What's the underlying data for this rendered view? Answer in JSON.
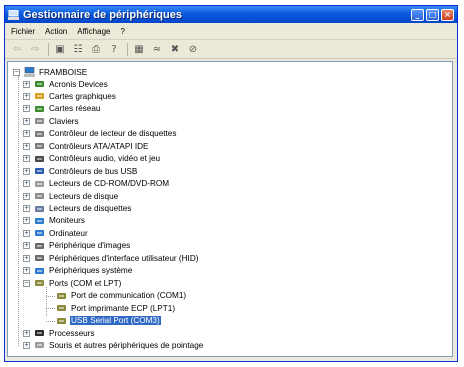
{
  "window": {
    "title": "Gestionnaire de périphériques",
    "min": "_",
    "max": "□",
    "close": "×"
  },
  "menu": [
    {
      "label": "Fichier"
    },
    {
      "label": "Action"
    },
    {
      "label": "Affichage"
    },
    {
      "label": "?"
    }
  ],
  "toolbar": [
    {
      "name": "back-arrow-icon",
      "glyph": "⇦"
    },
    {
      "name": "forward-arrow-icon",
      "glyph": "⇨"
    },
    {
      "name": "console-tree-icon",
      "glyph": "▣"
    },
    {
      "name": "properties-icon",
      "glyph": "☷"
    },
    {
      "name": "print-icon",
      "glyph": "⎙"
    },
    {
      "name": "help-icon",
      "glyph": "?"
    },
    {
      "name": "scan-hardware-icon",
      "glyph": "▦"
    },
    {
      "name": "update-driver-icon",
      "glyph": "≈"
    },
    {
      "name": "uninstall-icon",
      "glyph": "✖"
    },
    {
      "name": "disable-icon",
      "glyph": "⊘"
    }
  ],
  "tree": {
    "root": "FRAMBOISE",
    "items": [
      {
        "label": "Acronis Devices",
        "icon": "device-icon",
        "color": "#3a8a2a"
      },
      {
        "label": "Cartes graphiques",
        "icon": "display-adapter-icon",
        "color": "#d8a020"
      },
      {
        "label": "Cartes réseau",
        "icon": "network-adapter-icon",
        "color": "#3a8a2a"
      },
      {
        "label": "Claviers",
        "icon": "keyboard-icon",
        "color": "#8a8a8a"
      },
      {
        "label": "Contrôleur de lecteur de disquettes",
        "icon": "floppy-controller-icon",
        "color": "#7a7a7a"
      },
      {
        "label": "Contrôleurs ATA/ATAPI IDE",
        "icon": "ide-controller-icon",
        "color": "#7a7a7a"
      },
      {
        "label": "Contrôleurs audio, vidéo et jeu",
        "icon": "audio-icon",
        "color": "#4a4a4a"
      },
      {
        "label": "Contrôleurs de bus USB",
        "icon": "usb-icon",
        "color": "#2a5ab0"
      },
      {
        "label": "Lecteurs de CD-ROM/DVD-ROM",
        "icon": "cdrom-icon",
        "color": "#9a9a9a"
      },
      {
        "label": "Lecteurs de disque",
        "icon": "disk-icon",
        "color": "#8a8a8a"
      },
      {
        "label": "Lecteurs de disquettes",
        "icon": "floppy-drive-icon",
        "color": "#6a7aa0"
      },
      {
        "label": "Moniteurs",
        "icon": "monitor-icon",
        "color": "#2a7ad0"
      },
      {
        "label": "Ordinateur",
        "icon": "computer-icon",
        "color": "#2a7ad0"
      },
      {
        "label": "Périphérique d'images",
        "icon": "camera-icon",
        "color": "#6a6a6a"
      },
      {
        "label": "Périphériques d'interface utilisateur (HID)",
        "icon": "hid-icon",
        "color": "#6a6a6a"
      },
      {
        "label": "Périphériques système",
        "icon": "system-device-icon",
        "color": "#2a7ad0"
      },
      {
        "label": "Ports (COM et LPT)",
        "icon": "port-icon",
        "color": "#8a8a3a",
        "expanded": true
      },
      {
        "label": "Port de communication (COM1)",
        "icon": "port-icon",
        "color": "#8a8a3a",
        "child": true
      },
      {
        "label": "Port imprimante ECP (LPT1)",
        "icon": "port-icon",
        "color": "#8a8a3a",
        "child": true
      },
      {
        "label": "USB Serial Port (COM3)",
        "icon": "port-icon",
        "color": "#8a8a3a",
        "child": true,
        "selected": true
      },
      {
        "label": "Processeurs",
        "icon": "processor-icon",
        "color": "#2a2a2a"
      },
      {
        "label": "Souris et autres périphériques de pointage",
        "icon": "mouse-icon",
        "color": "#9a9a9a"
      }
    ]
  }
}
